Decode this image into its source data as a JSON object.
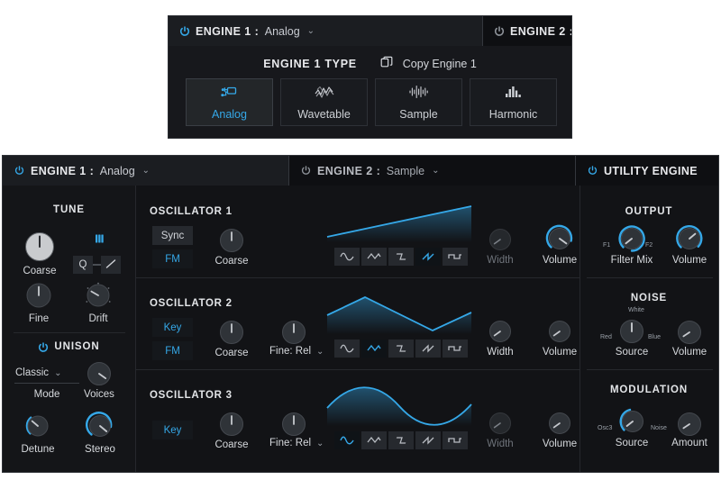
{
  "popup": {
    "tabs": [
      {
        "label": "ENGINE 1",
        "sep": ":",
        "value": "Analog",
        "power": "power-icon",
        "power_on": true,
        "chevron": "⌄"
      },
      {
        "label": "ENGINE 2",
        "sep": ":",
        "value": "",
        "power": "power-icon",
        "power_on": false,
        "chevron": ""
      }
    ],
    "title": "ENGINE 1 TYPE",
    "copy_label": "Copy Engine 1",
    "copy_icon": "copy-icon",
    "types": [
      {
        "label": "Analog",
        "icon": "analog-icon",
        "selected": true
      },
      {
        "label": "Wavetable",
        "icon": "wavetable-icon",
        "selected": false
      },
      {
        "label": "Sample",
        "icon": "sample-icon",
        "selected": false
      },
      {
        "label": "Harmonic",
        "icon": "harmonic-icon",
        "selected": false
      }
    ]
  },
  "panel": {
    "tabs": [
      {
        "label": "ENGINE 1",
        "sep": ":",
        "value": "Analog",
        "chevron": "⌄",
        "power_on": true,
        "active": true
      },
      {
        "label": "ENGINE 2",
        "sep": ":",
        "value": "Sample",
        "chevron": "⌄",
        "power_on": false,
        "active": false
      },
      {
        "label": "UTILITY ENGINE",
        "sep": "",
        "value": "",
        "chevron": "",
        "power_on": true,
        "active": false
      }
    ],
    "tune": {
      "title": "TUNE",
      "keyboard_icon": "piano-keys-icon",
      "q_button": "Q",
      "glide_icon": "glide-icon",
      "knobs": [
        {
          "label": "Coarse",
          "value": 0.5,
          "arc": false,
          "light": true
        },
        {
          "label": "Fine",
          "value": 0.5,
          "arc": false,
          "light": false
        },
        {
          "label": "Drift",
          "value": 0.28,
          "arc": false,
          "light": false
        }
      ]
    },
    "unison": {
      "title": "UNISON",
      "power_on": true,
      "mode_value": "Classic",
      "mode_chevron": "⌄",
      "mode_label": "Mode",
      "knobs": [
        {
          "label": "Voices",
          "value": 0.62,
          "arc": false
        },
        {
          "label": "Detune",
          "value": 0.22,
          "arc": true
        },
        {
          "label": "Stereo",
          "value": 0.68,
          "arc": true
        }
      ]
    },
    "oscillators": [
      {
        "title": "OSCILLATOR 1",
        "buttons": [
          {
            "label": "Sync",
            "on": false
          },
          {
            "label": "FM",
            "on": true
          }
        ],
        "knobs": [
          {
            "label": "Coarse",
            "value": 0.5,
            "dim": false
          }
        ],
        "fine_dropdown": null,
        "wave": "saw-up",
        "wave_selected_index": 3,
        "width": {
          "label": "Width",
          "value": 0.3,
          "dim": true,
          "arc": false
        },
        "volume": {
          "label": "Volume",
          "value": 0.72,
          "dim": false,
          "arc": true
        }
      },
      {
        "title": "OSCILLATOR 2",
        "buttons": [
          {
            "label": "Key",
            "on": true
          },
          {
            "label": "FM",
            "on": true
          }
        ],
        "knobs": [
          {
            "label": "Coarse",
            "value": 0.5,
            "dim": false
          }
        ],
        "fine_dropdown": {
          "label": "Fine: Rel",
          "chevron": "⌄"
        },
        "wave": "triangle",
        "wave_selected_index": 1,
        "width": {
          "label": "Width",
          "value": 0.3,
          "dim": false,
          "arc": false
        },
        "volume": {
          "label": "Volume",
          "value": 0.3,
          "dim": false,
          "arc": false
        }
      },
      {
        "title": "OSCILLATOR 3",
        "buttons": [
          {
            "label": "Key",
            "on": true
          }
        ],
        "knobs": [
          {
            "label": "Coarse",
            "value": 0.5,
            "dim": false
          }
        ],
        "fine_dropdown": {
          "label": "Fine: Rel",
          "chevron": "⌄"
        },
        "wave": "sine",
        "wave_selected_index": 0,
        "width": {
          "label": "Width",
          "value": 0.3,
          "dim": true,
          "arc": false
        },
        "volume": {
          "label": "Volume",
          "value": 0.3,
          "dim": false,
          "arc": false
        }
      }
    ],
    "output": {
      "title": "OUTPUT",
      "filter_mix": {
        "label": "Filter Mix",
        "value": 0.45,
        "arc": true,
        "min_label": "F1",
        "max_label": "F2"
      },
      "volume": {
        "label": "Volume",
        "value": 0.6,
        "arc": true
      }
    },
    "noise": {
      "title": "NOISE",
      "source": {
        "label": "Source",
        "value": 0.5,
        "arc": false,
        "top_label": "White",
        "min_label": "Red",
        "max_label": "Blue"
      },
      "volume": {
        "label": "Volume",
        "value": 0.58,
        "arc": false
      }
    },
    "modulation": {
      "title": "MODULATION",
      "source": {
        "label": "Source",
        "value": 0.38,
        "arc": true,
        "min_label": "Osc3",
        "max_label": "Noise"
      },
      "amount": {
        "label": "Amount",
        "value": 0.55,
        "arc": false
      }
    },
    "waveform_buttons": [
      "sine",
      "triangle",
      "saw-down",
      "saw-up",
      "square"
    ]
  },
  "colors": {
    "accent": "#35a8e8",
    "panel_bg": "#121316",
    "sidebar_bg": "#141518",
    "tab_active": "#1b1d21",
    "text": "#d6d9dd"
  }
}
